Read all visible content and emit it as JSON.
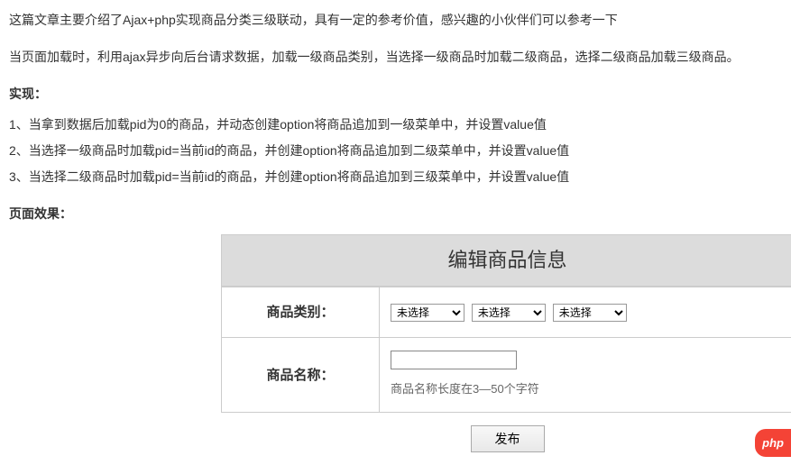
{
  "article": {
    "intro": "这篇文章主要介绍了Ajax+php实现商品分类三级联动，具有一定的参考价值，感兴趣的小伙伴们可以参考一下",
    "desc": "当页面加载时，利用ajax异步向后台请求数据，加载一级商品类别，当选择一级商品时加载二级商品，选择二级商品加载三级商品。",
    "impl_heading": "实现：",
    "steps": [
      "1、当拿到数据后加载pid为0的商品，并动态创建option将商品追加到一级菜单中，并设置value值",
      "2、当选择一级商品时加载pid=当前id的商品，并创建option将商品追加到二级菜单中，并设置value值",
      "3、当选择二级商品时加载pid=当前id的商品，并创建option将商品追加到三级菜单中，并设置value值"
    ],
    "effect_heading": "页面效果："
  },
  "form": {
    "title": "编辑商品信息",
    "category_label": "商品类别：",
    "name_label": "商品名称：",
    "select_default": "未选择",
    "name_hint": "商品名称长度在3—50个字符",
    "submit_label": "发布"
  },
  "badge": "php"
}
